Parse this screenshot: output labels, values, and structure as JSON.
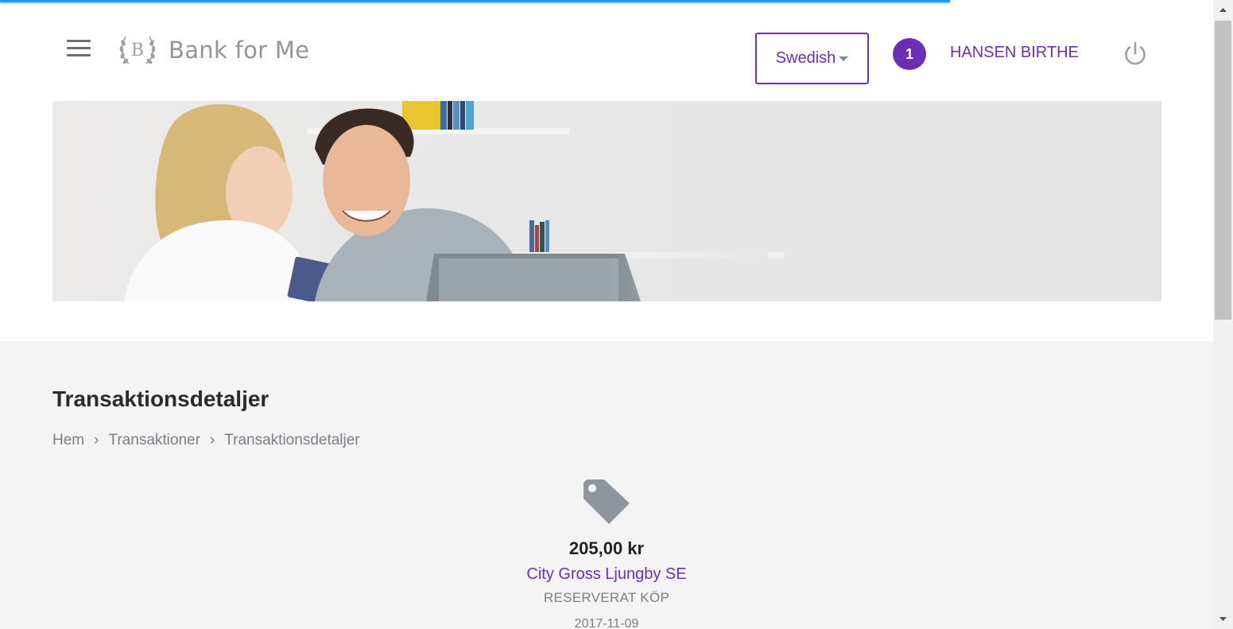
{
  "header": {
    "brand": "Bank for Me",
    "logo_letter": "B",
    "language": "Swedish",
    "notification_count": "1",
    "user_name": "HANSEN BIRTHE"
  },
  "hero": {
    "image": "couple-with-laptop-and-card"
  },
  "main": {
    "title": "Transaktionsdetaljer",
    "breadcrumb": [
      "Hem",
      "Transaktioner",
      "Transaktionsdetaljer"
    ],
    "breadcrumb_separator": "›"
  },
  "transaction": {
    "icon": "tag-icon",
    "amount": "205,00 kr",
    "merchant": "City Gross Ljungby SE",
    "status": "RESERVERAT KÖP",
    "date": "2017-11-09"
  },
  "colors": {
    "accent": "#6a2fb5",
    "loading_bar": "#2196f3",
    "content_bg": "#f4f4f4",
    "muted_text": "#7a7f86"
  }
}
